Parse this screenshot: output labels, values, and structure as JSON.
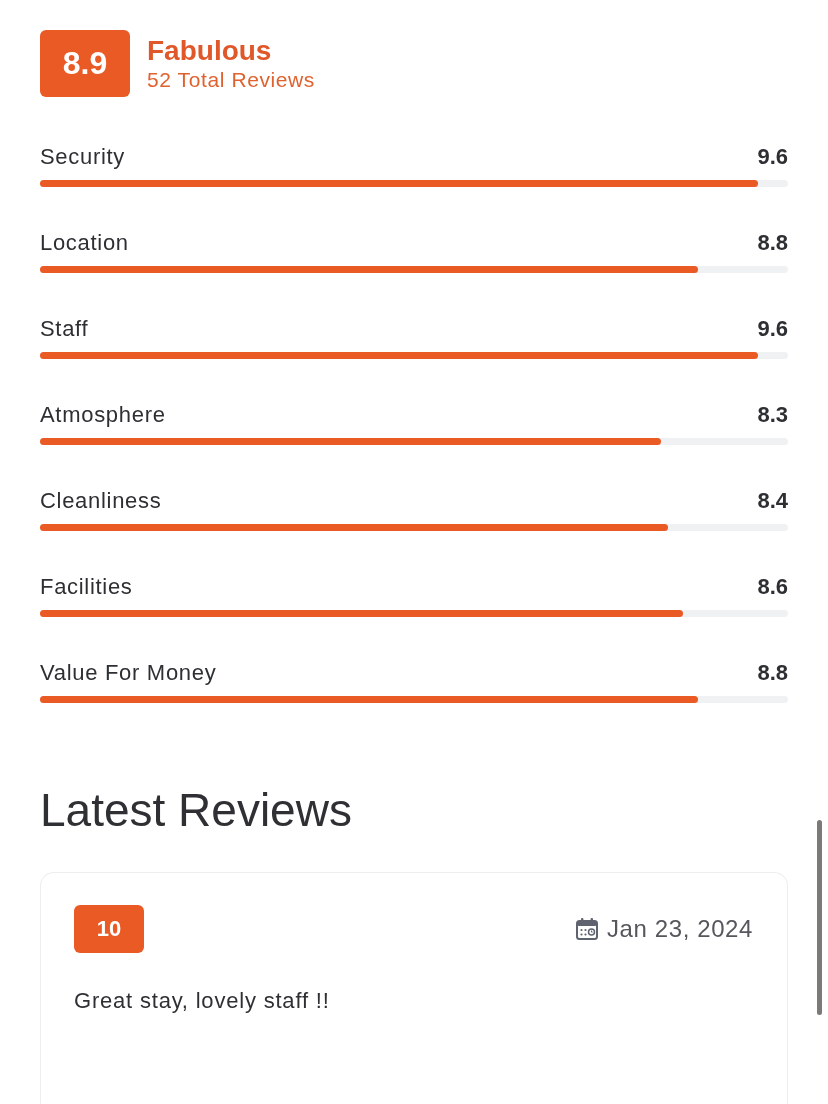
{
  "overall": {
    "score": "8.9",
    "label": "Fabulous",
    "total": "52 Total Reviews"
  },
  "categories": [
    {
      "name": "Security",
      "score": "9.6",
      "level": 0.96
    },
    {
      "name": "Location",
      "score": "8.8",
      "level": 0.88
    },
    {
      "name": "Staff",
      "score": "9.6",
      "level": 0.96
    },
    {
      "name": "Atmosphere",
      "score": "8.3",
      "level": 0.83
    },
    {
      "name": "Cleanliness",
      "score": "8.4",
      "level": 0.84
    },
    {
      "name": "Facilities",
      "score": "8.6",
      "level": 0.86
    },
    {
      "name": "Value For Money",
      "score": "8.8",
      "level": 0.88
    }
  ],
  "latest_reviews": {
    "title": "Latest Reviews",
    "reviews": [
      {
        "score": "10",
        "date": "Jan 23, 2024",
        "text": "Great stay, lovely staff !!"
      }
    ]
  }
}
